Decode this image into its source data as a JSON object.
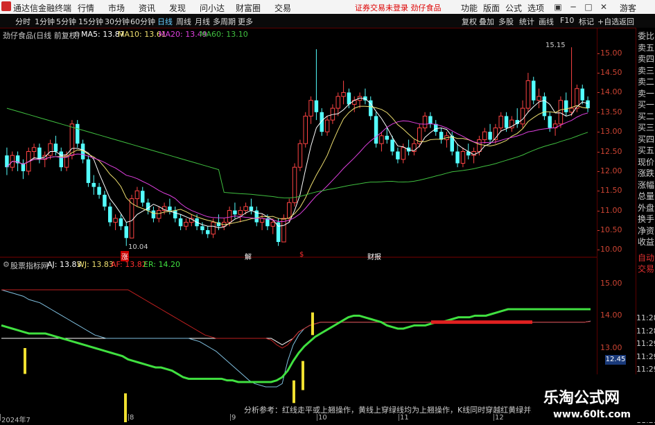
{
  "app": {
    "title": "通达信金融终端",
    "menus": [
      "行情",
      "市场",
      "资讯",
      "发现",
      "问小达",
      "财富圈",
      "交易"
    ],
    "notice": "证券交易未登录  劲仔食品",
    "toolbar_right": [
      "功能",
      "版面",
      "公式",
      "选项"
    ],
    "guest": "游客"
  },
  "periods": [
    "分时",
    "1分钟",
    "5分钟",
    "15分钟",
    "30分钟",
    "60分钟",
    "日线",
    "周线",
    "月线",
    "多周期",
    "更多"
  ],
  "selected_period": "日线",
  "right_tools": [
    "复权",
    "叠加",
    "多股",
    "统计",
    "画线",
    "F10",
    "标记",
    "+自选",
    "返回"
  ],
  "main_legend": {
    "stock": "劲仔食品(日线 前复权)",
    "ma5": "MA5: 13.87",
    "ma10": "MA10: 13.61",
    "ma20": "MA20: 13.49",
    "ma60": "MA60: 13.10"
  },
  "ind_legend": {
    "name": "股票指标网",
    "aj": "AJ: 13.83",
    "wj": "WJ: 13.83",
    "af": "AF: 13.82",
    "er": "ER: 14.20"
  },
  "annotations": {
    "high": "15.15",
    "low": "10.04",
    "marks": [
      "涨",
      "解",
      "$",
      "财报"
    ]
  },
  "bottom_hint": "分析参考：红线走平或上翘操作，黄线上穿绿线均为上翘操作，K线同时穿越红黄绿并站稳且绿",
  "ind_value_tag": "12.45",
  "sidebar_items": [
    "委比",
    "卖五",
    "卖四",
    "卖三",
    "卖二",
    "卖一",
    "买一",
    "买二",
    "买三",
    "买四",
    "买五",
    "现价",
    "涨跌",
    "涨幅",
    "总量",
    "外盘",
    "换手",
    "净资",
    "收益",
    "自动",
    "交易"
  ],
  "sidebar_times": [
    "11:28",
    "11:28",
    "11:29",
    "11:29",
    "11:29",
    "11:29",
    "11:29",
    "11:29",
    "11:29"
  ],
  "date_labels": [
    "2024年7",
    "8",
    "9",
    "10",
    "11",
    "12"
  ],
  "watermark": {
    "name": "乐淘公式网",
    "url": "www.60lt.com"
  },
  "colors": {
    "up": "#ff4444",
    "down": "#54ffff",
    "ma5": "#ffffff",
    "ma10": "#f0e070",
    "ma20": "#e040e0",
    "ma60": "#40c040"
  },
  "chart_data": [
    {
      "type": "candlestick",
      "y_ticks": [
        "15.00",
        "14.50",
        "14.00",
        "13.50",
        "13.00",
        "12.50",
        "12.00",
        "11.50",
        "11.00",
        "10.50",
        "10.00"
      ],
      "ylim": [
        9.9,
        15.4
      ],
      "ohlc": [
        [
          12.4,
          12.6,
          11.9,
          12.1
        ],
        [
          12.1,
          12.5,
          12.0,
          12.4
        ],
        [
          12.4,
          12.5,
          12.0,
          12.2
        ],
        [
          12.2,
          12.3,
          11.8,
          12.0
        ],
        [
          12.0,
          12.6,
          11.9,
          12.5
        ],
        [
          12.5,
          12.7,
          12.3,
          12.6
        ],
        [
          12.6,
          12.7,
          12.2,
          12.3
        ],
        [
          12.3,
          12.5,
          12.1,
          12.4
        ],
        [
          12.4,
          12.8,
          12.3,
          12.7
        ],
        [
          12.7,
          12.9,
          12.4,
          12.5
        ],
        [
          12.5,
          12.6,
          12.0,
          12.1
        ],
        [
          12.1,
          12.5,
          12.0,
          12.4
        ],
        [
          12.4,
          13.3,
          12.3,
          13.2
        ],
        [
          13.2,
          13.3,
          12.6,
          12.7
        ],
        [
          12.7,
          12.8,
          12.2,
          12.3
        ],
        [
          12.3,
          12.4,
          11.6,
          11.7
        ],
        [
          11.7,
          11.9,
          11.4,
          11.6
        ],
        [
          11.6,
          11.7,
          11.3,
          11.4
        ],
        [
          11.4,
          11.5,
          11.0,
          11.1
        ],
        [
          11.1,
          11.2,
          10.6,
          10.7
        ],
        [
          10.7,
          10.9,
          10.5,
          10.8
        ],
        [
          10.8,
          10.9,
          10.5,
          10.6
        ],
        [
          10.6,
          10.7,
          10.1,
          10.3
        ],
        [
          10.3,
          11.4,
          10.3,
          11.3
        ],
        [
          11.3,
          11.6,
          11.1,
          11.5
        ],
        [
          11.5,
          11.6,
          11.1,
          11.2
        ],
        [
          11.2,
          11.3,
          10.9,
          11.0
        ],
        [
          11.0,
          11.1,
          10.7,
          10.8
        ],
        [
          10.8,
          11.1,
          10.7,
          11.0
        ],
        [
          11.0,
          11.2,
          10.9,
          11.1
        ],
        [
          11.1,
          11.3,
          10.9,
          11.0
        ],
        [
          11.0,
          11.1,
          10.7,
          10.8
        ],
        [
          10.8,
          10.9,
          10.5,
          10.6
        ],
        [
          10.6,
          10.8,
          10.5,
          10.7
        ],
        [
          10.7,
          10.9,
          10.6,
          10.8
        ],
        [
          10.8,
          10.9,
          10.5,
          10.6
        ],
        [
          10.6,
          10.7,
          10.4,
          10.5
        ],
        [
          10.5,
          10.6,
          10.3,
          10.4
        ],
        [
          10.4,
          10.8,
          10.3,
          10.7
        ],
        [
          10.7,
          10.9,
          10.5,
          10.6
        ],
        [
          10.6,
          10.8,
          10.5,
          10.7
        ],
        [
          10.7,
          11.1,
          10.6,
          11.0
        ],
        [
          11.0,
          11.2,
          10.8,
          10.9
        ],
        [
          10.9,
          11.1,
          10.7,
          11.0
        ],
        [
          11.0,
          11.2,
          10.9,
          11.1
        ],
        [
          11.1,
          11.3,
          10.9,
          11.0
        ],
        [
          11.0,
          11.1,
          10.6,
          10.7
        ],
        [
          10.7,
          10.9,
          10.5,
          10.8
        ],
        [
          10.8,
          10.9,
          10.5,
          10.6
        ],
        [
          10.6,
          10.8,
          10.4,
          10.7
        ],
        [
          10.7,
          10.8,
          10.1,
          10.2
        ],
        [
          10.2,
          10.9,
          10.2,
          10.8
        ],
        [
          10.8,
          11.3,
          10.7,
          11.2
        ],
        [
          11.2,
          12.2,
          11.1,
          12.1
        ],
        [
          12.1,
          12.8,
          12.0,
          12.7
        ],
        [
          12.7,
          13.5,
          12.6,
          13.4
        ],
        [
          13.4,
          13.9,
          13.2,
          13.8
        ],
        [
          13.8,
          15.1,
          13.3,
          13.5
        ],
        [
          13.5,
          13.6,
          12.9,
          13.0
        ],
        [
          13.0,
          13.4,
          12.9,
          13.3
        ],
        [
          13.3,
          13.7,
          13.2,
          13.6
        ],
        [
          13.6,
          14.0,
          13.4,
          13.9
        ],
        [
          13.9,
          14.3,
          13.7,
          14.0
        ],
        [
          14.0,
          14.1,
          13.6,
          13.7
        ],
        [
          13.7,
          13.9,
          13.5,
          13.8
        ],
        [
          13.8,
          14.0,
          13.6,
          13.9
        ],
        [
          13.9,
          14.1,
          13.7,
          13.8
        ],
        [
          13.8,
          13.9,
          13.3,
          13.4
        ],
        [
          13.4,
          13.5,
          12.6,
          12.7
        ],
        [
          12.7,
          13.0,
          12.5,
          12.9
        ],
        [
          12.9,
          13.1,
          12.7,
          12.8
        ],
        [
          12.8,
          12.9,
          12.4,
          12.5
        ],
        [
          12.5,
          12.6,
          12.2,
          12.3
        ],
        [
          12.3,
          12.7,
          12.2,
          12.6
        ],
        [
          12.6,
          12.8,
          12.4,
          12.5
        ],
        [
          12.5,
          12.8,
          12.4,
          12.7
        ],
        [
          12.7,
          13.2,
          12.6,
          13.1
        ],
        [
          13.1,
          13.5,
          13.0,
          13.4
        ],
        [
          13.4,
          13.5,
          13.1,
          13.2
        ],
        [
          13.2,
          13.3,
          12.9,
          13.0
        ],
        [
          13.0,
          13.1,
          12.7,
          12.8
        ],
        [
          12.8,
          13.0,
          12.6,
          12.9
        ],
        [
          12.9,
          13.0,
          12.4,
          12.5
        ],
        [
          12.5,
          12.7,
          12.1,
          12.2
        ],
        [
          12.2,
          12.6,
          12.1,
          12.5
        ],
        [
          12.5,
          12.7,
          12.3,
          12.4
        ],
        [
          12.4,
          12.6,
          12.2,
          12.5
        ],
        [
          12.5,
          12.9,
          12.4,
          12.8
        ],
        [
          12.8,
          13.1,
          12.7,
          13.0
        ],
        [
          13.0,
          13.2,
          12.7,
          12.8
        ],
        [
          12.8,
          13.2,
          12.7,
          13.1
        ],
        [
          13.1,
          13.5,
          13.0,
          13.4
        ],
        [
          13.4,
          13.5,
          13.0,
          13.1
        ],
        [
          13.1,
          13.4,
          13.0,
          13.3
        ],
        [
          13.3,
          13.6,
          13.1,
          13.2
        ],
        [
          13.2,
          13.8,
          13.1,
          13.6
        ],
        [
          13.6,
          14.5,
          13.5,
          14.3
        ],
        [
          14.3,
          14.4,
          13.7,
          13.8
        ],
        [
          13.8,
          14.1,
          13.6,
          13.9
        ],
        [
          13.9,
          14.0,
          13.3,
          13.4
        ],
        [
          13.4,
          13.5,
          13.0,
          13.1
        ],
        [
          13.1,
          13.3,
          12.9,
          13.2
        ],
        [
          13.2,
          13.9,
          13.1,
          13.8
        ],
        [
          13.8,
          14.0,
          13.4,
          13.5
        ],
        [
          13.5,
          15.15,
          13.4,
          13.6
        ],
        [
          13.6,
          14.2,
          13.5,
          14.1
        ],
        [
          14.1,
          14.2,
          13.7,
          13.8
        ],
        [
          13.8,
          13.9,
          13.5,
          13.6
        ]
      ]
    },
    {
      "type": "line",
      "y_ticks": [
        "15.00",
        "14.00",
        "13.00",
        "12.00"
      ],
      "ylim": [
        10.9,
        15.4
      ],
      "series": [
        {
          "name": "AJ",
          "values": [
            13.3,
            13.3,
            13.3,
            13.3,
            13.3,
            13.3,
            13.3,
            13.3,
            13.3,
            13.3,
            13.3,
            13.3,
            13.3,
            13.3,
            13.3,
            13.3,
            13.3,
            13.3,
            13.3,
            13.3,
            13.3,
            13.3,
            13.3,
            13.3,
            13.3,
            13.3,
            13.3,
            13.3,
            13.3,
            13.3,
            13.3,
            13.3,
            13.3,
            13.3,
            13.3,
            13.3,
            13.3,
            13.3,
            13.3,
            13.3,
            13.3,
            13.3,
            13.3,
            13.3,
            13.3,
            13.3,
            13.3,
            13.3,
            13.3,
            13.3,
            13.2,
            13.1,
            13.2,
            13.3,
            13.5,
            13.6,
            13.7,
            13.75,
            13.8,
            13.8,
            13.8,
            13.8,
            13.8,
            13.8,
            13.8,
            13.8,
            13.8,
            13.8,
            13.8,
            13.8,
            13.8,
            13.8,
            13.8,
            13.8,
            13.8,
            13.8,
            13.8,
            13.8,
            13.8,
            13.8,
            13.8,
            13.8,
            13.8,
            13.8,
            13.8,
            13.8,
            13.8,
            13.8,
            13.8,
            13.8,
            13.8,
            13.8,
            13.8,
            13.8,
            13.8,
            13.8,
            13.8,
            13.8,
            13.8,
            13.8,
            13.8,
            13.8,
            13.8,
            13.8,
            13.8,
            13.8,
            13.8,
            13.83
          ]
        },
        {
          "name": "WJ",
          "values": [
            14.8,
            14.75,
            14.7,
            14.65,
            14.6,
            14.5,
            14.45,
            14.4,
            14.3,
            14.2,
            14.1,
            14.0,
            13.9,
            13.8,
            13.7,
            13.6,
            13.5,
            13.4,
            13.35,
            13.3,
            13.3,
            13.3,
            13.3,
            13.3,
            13.3,
            13.3,
            13.3,
            13.3,
            13.3,
            13.3,
            13.3,
            13.3,
            13.3,
            13.3,
            13.3,
            13.25,
            13.2,
            13.1,
            13.0,
            12.9,
            12.75,
            12.6,
            12.45,
            12.3,
            12.15,
            12.0,
            11.9,
            11.85,
            11.8,
            11.8,
            11.8,
            11.9,
            12.6,
            13.1,
            13.4,
            13.6,
            13.7,
            13.75,
            13.8,
            13.8,
            13.8,
            13.8,
            13.8,
            13.8,
            13.8,
            13.8,
            13.8,
            13.8,
            13.8,
            13.8,
            13.8,
            13.8,
            13.8,
            13.8,
            13.8,
            13.8,
            13.8,
            13.8,
            13.8,
            13.8,
            13.8,
            13.8,
            13.8,
            13.8,
            13.8,
            13.8,
            13.8,
            13.8,
            13.8,
            13.8,
            13.8,
            13.8,
            13.8,
            13.8,
            13.8,
            13.8,
            13.8,
            13.8,
            13.8,
            13.8,
            13.8,
            13.8,
            13.8,
            13.8,
            13.8,
            13.8,
            13.8,
            13.83
          ]
        },
        {
          "name": "AF",
          "values": [
            14.8,
            14.8,
            14.8,
            14.8,
            14.8,
            14.8,
            14.8,
            14.8,
            14.8,
            14.8,
            14.8,
            14.8,
            14.8,
            14.8,
            14.8,
            14.8,
            14.8,
            14.8,
            14.8,
            14.8,
            14.8,
            14.8,
            14.8,
            14.8,
            14.7,
            14.6,
            14.5,
            14.4,
            14.3,
            14.2,
            14.1,
            14.0,
            13.9,
            13.8,
            13.7,
            13.6,
            13.5,
            13.4,
            13.35,
            13.3,
            13.3,
            13.3,
            13.3,
            13.3,
            13.3,
            13.3,
            13.3,
            13.3,
            13.3,
            13.25,
            13.1,
            13.0,
            13.1,
            13.3,
            13.5,
            13.6,
            13.7,
            13.75,
            13.8,
            13.8,
            13.8,
            13.8,
            13.8,
            13.8,
            13.8,
            13.8,
            13.8,
            13.8,
            13.8,
            13.8,
            13.8,
            13.8,
            13.8,
            13.8,
            13.8,
            13.8,
            13.8,
            13.8,
            13.8,
            13.8,
            13.8,
            13.8,
            13.8,
            13.8,
            13.8,
            13.8,
            13.8,
            13.8,
            13.8,
            13.8,
            13.8,
            13.8,
            13.8,
            13.8,
            13.8,
            13.8,
            13.8,
            13.8,
            13.8,
            13.8,
            13.8,
            13.8,
            13.8,
            13.8,
            13.8,
            13.8,
            13.8,
            13.82
          ]
        },
        {
          "name": "ER",
          "values": [
            13.7,
            13.65,
            13.6,
            13.55,
            13.5,
            13.45,
            13.45,
            13.45,
            13.45,
            13.4,
            13.35,
            13.3,
            13.25,
            13.2,
            13.15,
            13.1,
            13.05,
            13.0,
            12.95,
            12.9,
            12.85,
            12.8,
            12.75,
            12.65,
            12.6,
            12.55,
            12.5,
            12.45,
            12.4,
            12.4,
            12.35,
            12.3,
            12.2,
            12.1,
            12.05,
            12.05,
            12.05,
            12.05,
            12.05,
            12.05,
            12.05,
            12.0,
            12.0,
            11.95,
            11.95,
            11.95,
            11.95,
            11.95,
            11.95,
            11.95,
            12.0,
            12.1,
            12.3,
            12.6,
            12.85,
            13.05,
            13.2,
            13.35,
            13.45,
            13.55,
            13.65,
            13.75,
            13.85,
            13.95,
            14.0,
            14.0,
            13.95,
            13.9,
            13.85,
            13.8,
            13.7,
            13.65,
            13.6,
            13.6,
            13.65,
            13.7,
            13.7,
            13.7,
            13.75,
            13.8,
            13.8,
            13.85,
            13.9,
            13.95,
            13.95,
            13.95,
            14.0,
            14.0,
            14.0,
            14.05,
            14.1,
            14.15,
            14.2,
            14.2,
            14.2,
            14.2,
            14.2,
            14.2,
            14.2,
            14.2,
            14.2,
            14.2,
            14.2,
            14.2,
            14.2,
            14.2,
            14.2,
            14.2
          ]
        }
      ]
    }
  ]
}
